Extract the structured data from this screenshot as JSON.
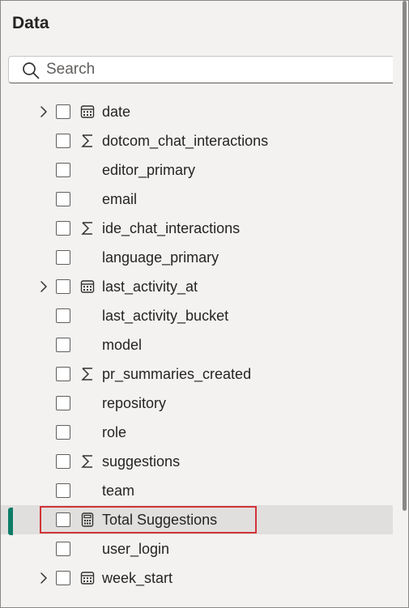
{
  "pane": {
    "title": "Data"
  },
  "search": {
    "placeholder": "Search",
    "value": ""
  },
  "fields": [
    {
      "label": "date",
      "icon": "calendar-table-icon",
      "expandable": true,
      "checked": false,
      "selected": false
    },
    {
      "label": "dotcom_chat_interactions",
      "icon": "sigma-icon",
      "expandable": false,
      "checked": false,
      "selected": false
    },
    {
      "label": "editor_primary",
      "icon": "",
      "expandable": false,
      "checked": false,
      "selected": false
    },
    {
      "label": "email",
      "icon": "",
      "expandable": false,
      "checked": false,
      "selected": false
    },
    {
      "label": "ide_chat_interactions",
      "icon": "sigma-icon",
      "expandable": false,
      "checked": false,
      "selected": false
    },
    {
      "label": "language_primary",
      "icon": "",
      "expandable": false,
      "checked": false,
      "selected": false
    },
    {
      "label": "last_activity_at",
      "icon": "calendar-table-icon",
      "expandable": true,
      "checked": false,
      "selected": false
    },
    {
      "label": "last_activity_bucket",
      "icon": "",
      "expandable": false,
      "checked": false,
      "selected": false
    },
    {
      "label": "model",
      "icon": "",
      "expandable": false,
      "checked": false,
      "selected": false
    },
    {
      "label": "pr_summaries_created",
      "icon": "sigma-icon",
      "expandable": false,
      "checked": false,
      "selected": false
    },
    {
      "label": "repository",
      "icon": "",
      "expandable": false,
      "checked": false,
      "selected": false
    },
    {
      "label": "role",
      "icon": "",
      "expandable": false,
      "checked": false,
      "selected": false
    },
    {
      "label": "suggestions",
      "icon": "sigma-icon",
      "expandable": false,
      "checked": false,
      "selected": false
    },
    {
      "label": "team",
      "icon": "",
      "expandable": false,
      "checked": false,
      "selected": false
    },
    {
      "label": "Total Suggestions",
      "icon": "calculator-icon",
      "expandable": false,
      "checked": false,
      "selected": true,
      "highlighted": true
    },
    {
      "label": "user_login",
      "icon": "",
      "expandable": false,
      "checked": false,
      "selected": false
    },
    {
      "label": "week_start",
      "icon": "calendar-table-icon",
      "expandable": true,
      "checked": false,
      "selected": false
    }
  ],
  "colors": {
    "selection_accent": "#0e7c66",
    "highlight_border": "#d13438",
    "selected_row_bg": "#e1dfdd",
    "pane_bg": "#f3f2f1"
  }
}
